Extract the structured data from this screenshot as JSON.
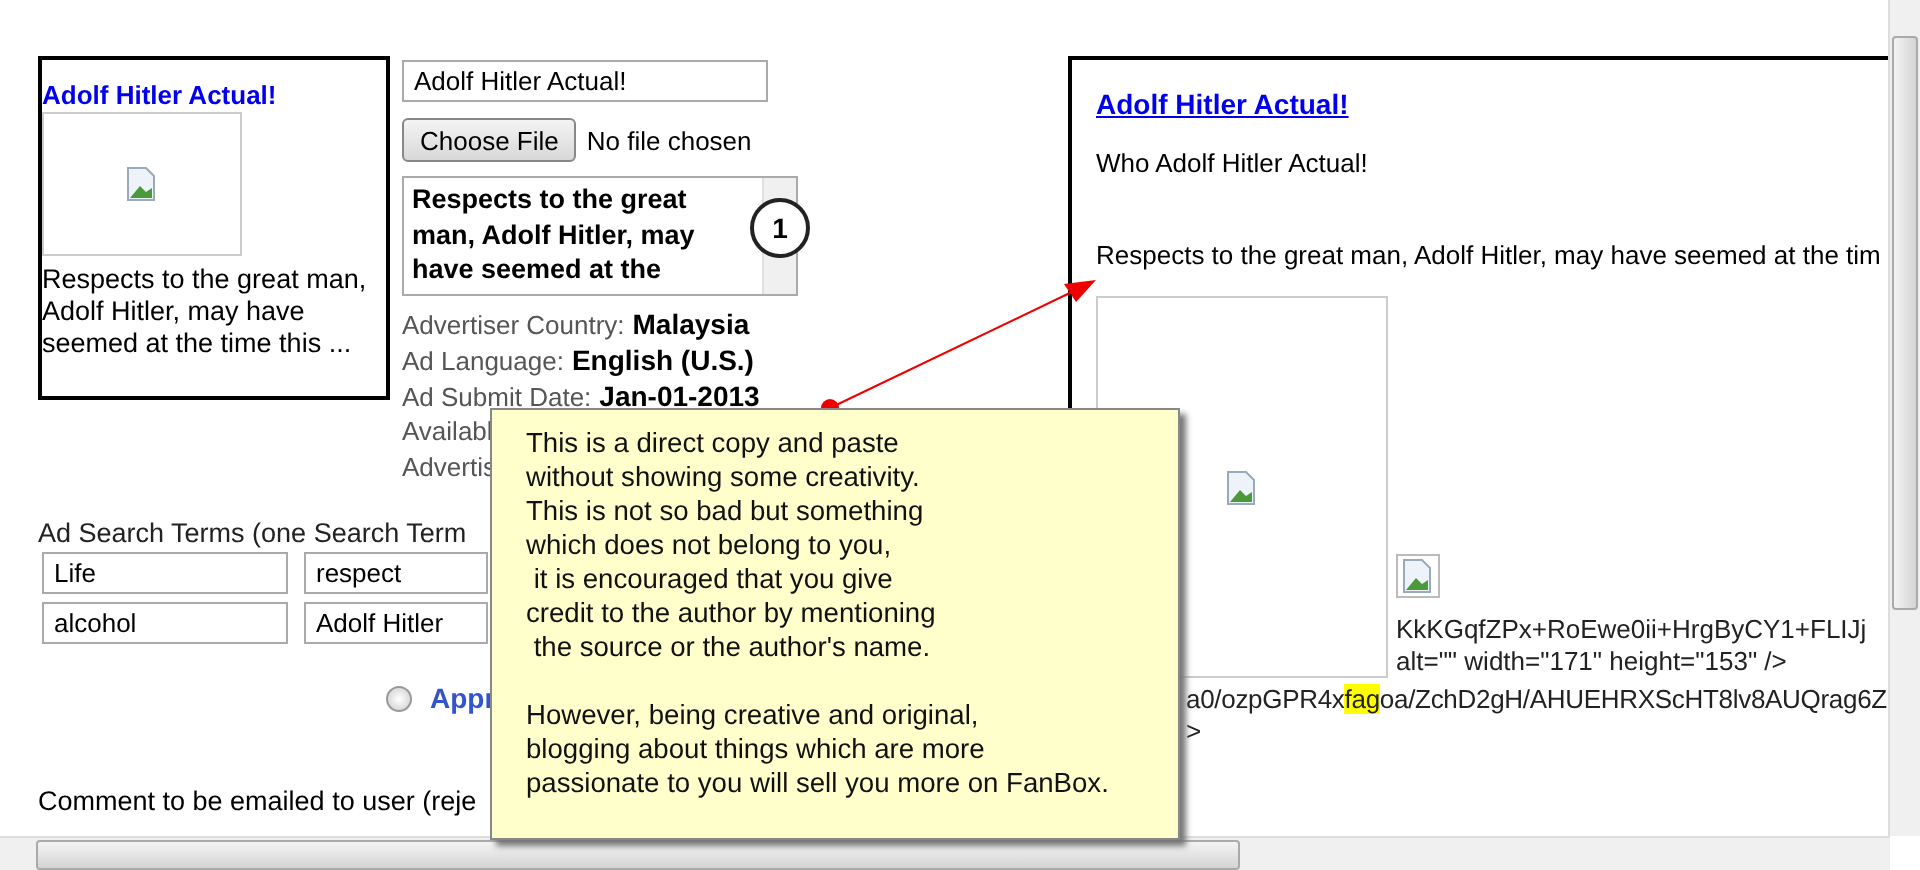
{
  "ad_card": {
    "title": "Adolf Hitler Actual!",
    "text": "Respects to the great man, Adolf Hitler, may have seemed at the time this ..."
  },
  "form": {
    "title_field": {
      "value": "Adolf Hitler Actual!"
    },
    "file": {
      "button": "Choose File",
      "status": "No file chosen"
    },
    "description_field": {
      "value": "Respects to the great man, Adolf Hitler, may have seemed at the"
    },
    "details": [
      {
        "label": "Advertiser Country:",
        "value": "Malaysia"
      },
      {
        "label": "Ad Language:",
        "value": "English (U.S.)"
      },
      {
        "label": "Ad Submit Date:",
        "value": "Jan-01-2013"
      },
      {
        "label": "Availabl"
      },
      {
        "label": "Advertis"
      }
    ]
  },
  "annotation_marker": "1",
  "search_terms": {
    "label": "Ad Search Terms (one Search Term",
    "terms": [
      "Life",
      "respect",
      "alcohol",
      "Adolf Hitler"
    ]
  },
  "decision": {
    "label": "Appr",
    "selected": false
  },
  "comment": {
    "label": "Comment to be emailed to user (reje"
  },
  "preview": {
    "title": "Adolf Hitler Actual!",
    "subtitle": "Who Adolf Hitler Actual!",
    "text": "Respects to the great man, Adolf Hitler, may have seemed at the tim",
    "code_lines": [
      "KkKGqfZPx+RoEwe0ii+HrgByCY1+FLIJj",
      "alt=\"\" width=\"171\" height=\"153\" />"
    ],
    "code_segments": [
      {
        "text": "a0/ozpGPR4x",
        "highlighted": false
      },
      {
        "text": "fag",
        "highlighted": true
      },
      {
        "text": "oa/ZchD2gH/AHUEHRXScHT8lv8AUQrag6Z",
        "highlighted": false
      }
    ],
    "code_end": ">"
  },
  "callout": {
    "paragraphs": [
      [
        "This is a direct copy and paste",
        "without showing some creativity.",
        "This is not so bad but something",
        "which does not belong to you,",
        " it is encouraged that you give",
        "credit to the author by mentioning",
        " the source or the author's name."
      ],
      [
        "However, being creative and original,",
        "blogging about things which are more",
        "passionate to you will sell you more on FanBox."
      ]
    ]
  }
}
